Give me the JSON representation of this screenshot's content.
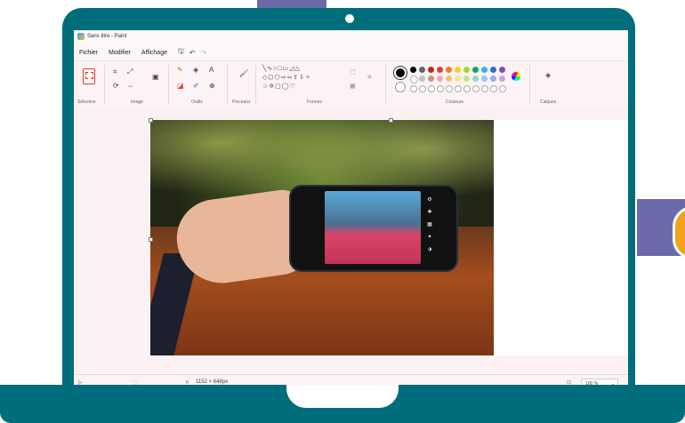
{
  "window": {
    "title": "Sans titre - Paint"
  },
  "menu": {
    "items": [
      "Fichier",
      "Modifier",
      "Affichage"
    ]
  },
  "ribbon": {
    "groups": {
      "selection": "Sélection",
      "image": "Image",
      "outils": "Outils",
      "pinceaux": "Pinceaux",
      "formes": "Formes",
      "couleurs": "Couleurs",
      "calques": "Calques"
    }
  },
  "colors": {
    "palette": [
      "#000000",
      "#666666",
      "#b7282e",
      "#e13b3b",
      "#f07d2d",
      "#f4d22c",
      "#a5d33b",
      "#1aa35a",
      "#35b3e2",
      "#2b6fd6",
      "#8b48b6"
    ],
    "palette_row2": [
      "#ffffff",
      "#c3c3c3",
      "#c89a80",
      "#f2a4c2",
      "#f7c46a",
      "#f1ea8a",
      "#bfe58b",
      "#8fd9c8",
      "#8ec9f0",
      "#9aa9f0",
      "#c8a4e2"
    ]
  },
  "status": {
    "image_size": "1152 × 648px",
    "zoom": "100 %"
  }
}
